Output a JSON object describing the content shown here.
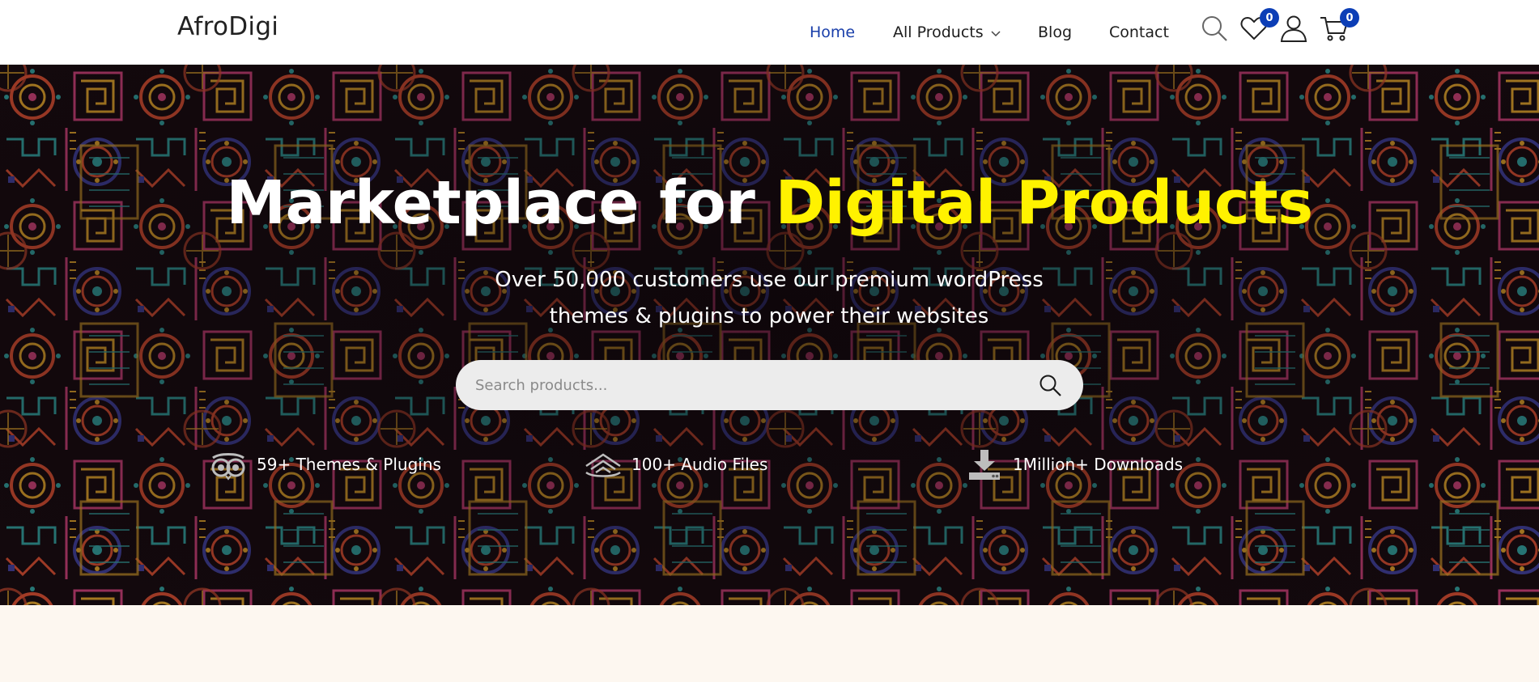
{
  "header": {
    "logo": "AfroDigi",
    "nav": {
      "home": "Home",
      "all_products": "All Products",
      "blog": "Blog",
      "contact": "Contact"
    },
    "wishlist_count": "0",
    "cart_count": "0"
  },
  "hero": {
    "title_main": "Marketplace for ",
    "title_accent": "Digital Products",
    "subtitle_line1": "Over 50,000 customers use our premium wordPress",
    "subtitle_line2": "themes & plugins to power their websites",
    "search_placeholder": "Search products...",
    "features": [
      {
        "icon": "owl-eyes-icon",
        "label": "59+ Themes & Plugins"
      },
      {
        "icon": "wifi-signal-icon",
        "label": "100+ Audio Files"
      },
      {
        "icon": "download-icon",
        "label": "1Million+ Downloads"
      }
    ]
  },
  "colors": {
    "accent_yellow": "#fff200",
    "nav_active": "#1a3faa",
    "badge_blue": "#0c3eb6",
    "hero_background": "#14090c",
    "page_background": "#fdf7f0"
  }
}
